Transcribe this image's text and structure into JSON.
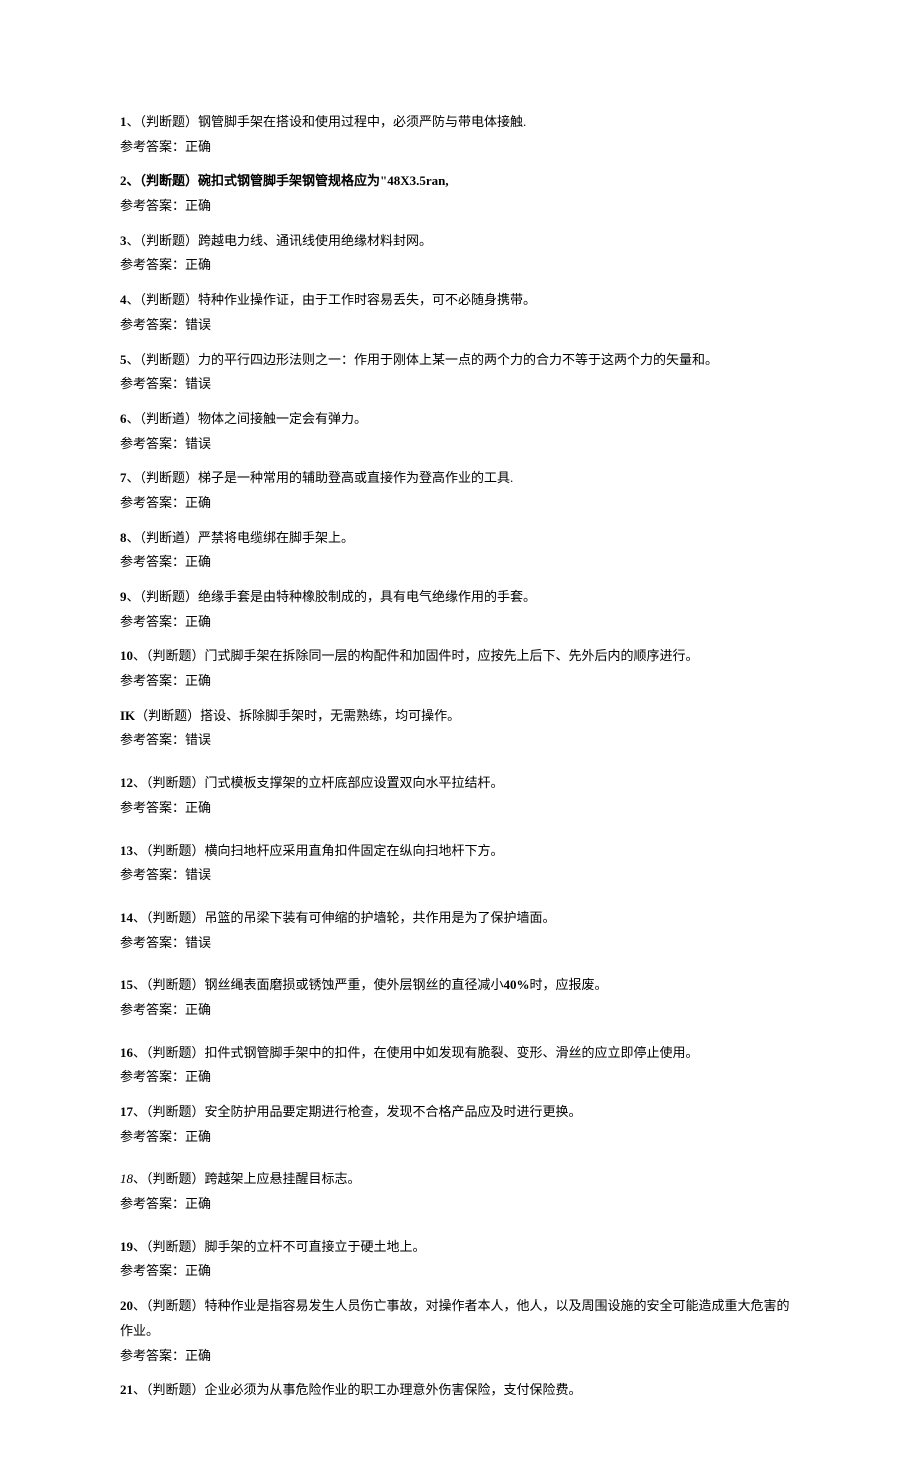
{
  "answer_label_prefix": "参考答案：",
  "items": [
    {
      "num": "1",
      "num_class": "num",
      "text": "、（判断题）钢管脚手架在搭设和使用过程中，必须严防与带电体接触.",
      "answer": "正确",
      "gap": false
    },
    {
      "num": "2",
      "num_class": "num",
      "text": "、（判断题）碗扣式钢管脚手架钢管规格应为\"48X3.5ran,",
      "bold_text": true,
      "answer": "正确",
      "gap": false
    },
    {
      "num": "3",
      "num_class": "num",
      "text": "、（判断题）跨越电力线、通讯线使用绝缘材料封网。",
      "answer": "正确",
      "gap": false
    },
    {
      "num": "4",
      "num_class": "num",
      "text": "、（判断题）特种作业操作证，由于工作时容易丢失，可不必随身携带。",
      "answer": "错误",
      "gap": false
    },
    {
      "num": "5",
      "num_class": "num",
      "text": "、（判断题）力的平行四边形法则之一：作用于刚体上某一点的两个力的合力不等于这两个力的矢量和。",
      "answer": "错误",
      "gap": false
    },
    {
      "num": "6",
      "num_class": "num",
      "text": "、（判断遒）物体之间接触一定会有弹力。",
      "answer": "错误",
      "gap": false
    },
    {
      "num": "7",
      "num_class": "num",
      "text": "、（判断题）梯子是一种常用的辅助登高或直接作为登高作业的工具.",
      "answer": "正确",
      "gap": false
    },
    {
      "num": "8",
      "num_class": "num",
      "text": "、（判断遒）严禁将电缆绑在脚手架上。",
      "answer": "正确",
      "gap": false
    },
    {
      "num": "9",
      "num_class": "num",
      "text": "、（判断题）绝缘手套是由特种橡胶制成的，具有电气绝缘作用的手套。",
      "answer": "正确",
      "gap": false
    },
    {
      "num": "10",
      "num_class": "num",
      "text": "、（判断题）门式脚手架在拆除同一层的构配件和加固件时，应按先上后下、先外后内的顺序进行。",
      "answer": "正确",
      "gap": false
    },
    {
      "num": "IK",
      "num_class": "num",
      "text": "（判断题）搭设、拆除脚手架时，无需熟练，均可操作。",
      "answer": "错误",
      "gap": true
    },
    {
      "num": "12",
      "num_class": "num",
      "text": "、（判断题）门式模板支撑架的立杆底部应设置双向水平拉结杆。",
      "answer": "正确",
      "gap": true
    },
    {
      "num": "13",
      "num_class": "num",
      "text": "、（判断题）横向扫地杆应采用直角扣件固定在纵向扫地杆下方。",
      "answer": "错误",
      "gap": true
    },
    {
      "num": "14",
      "num_class": "num",
      "text": "、（判断题）吊篮的吊梁下装有可伸缩的护墙轮，共作用是为了保护墙面。",
      "answer": "错误",
      "gap": true
    },
    {
      "num": "15",
      "num_class": "num",
      "text_html": "、（判断题）钢丝绳表面磨损或锈蚀严重，使外层钢丝的直径减小<span class=\"num\">40%</span>时，应报废。",
      "answer": "正确",
      "gap": true
    },
    {
      "num": "16",
      "num_class": "num",
      "text": "、（判断题）扣件式钢管脚手架中的扣件，在使用中如发现有脆裂、变形、滑丝的应立即停止使用。",
      "answer": "正确",
      "gap": false
    },
    {
      "num": "17",
      "num_class": "num",
      "text": "、（判断题）安全防护用品要定期进行枪查，发现不合格产品应及时进行更换。",
      "answer": "正确",
      "gap": true
    },
    {
      "num": "18",
      "num_class": "inum",
      "text": "、（判断题）跨越架上应悬挂醒目标志。",
      "answer": "正确",
      "gap": true
    },
    {
      "num": "19",
      "num_class": "num",
      "text": "、（判断题）脚手架的立杆不可直接立于硬土地上。",
      "answer": "正确",
      "gap": false
    },
    {
      "num": "20",
      "num_class": "num",
      "text": "、（判断题）特种作业是指容易发生人员伤亡事故，对操作者本人，他人，以及周围设施的安全可能造成重大危害的作业。",
      "answer": "正确",
      "gap": false
    },
    {
      "num": "21",
      "num_class": "num",
      "text": "、（判断题）企业必须为从事危险作业的职工办理意外伤害保险，支付保险费。",
      "answer": "",
      "gap": false
    }
  ]
}
